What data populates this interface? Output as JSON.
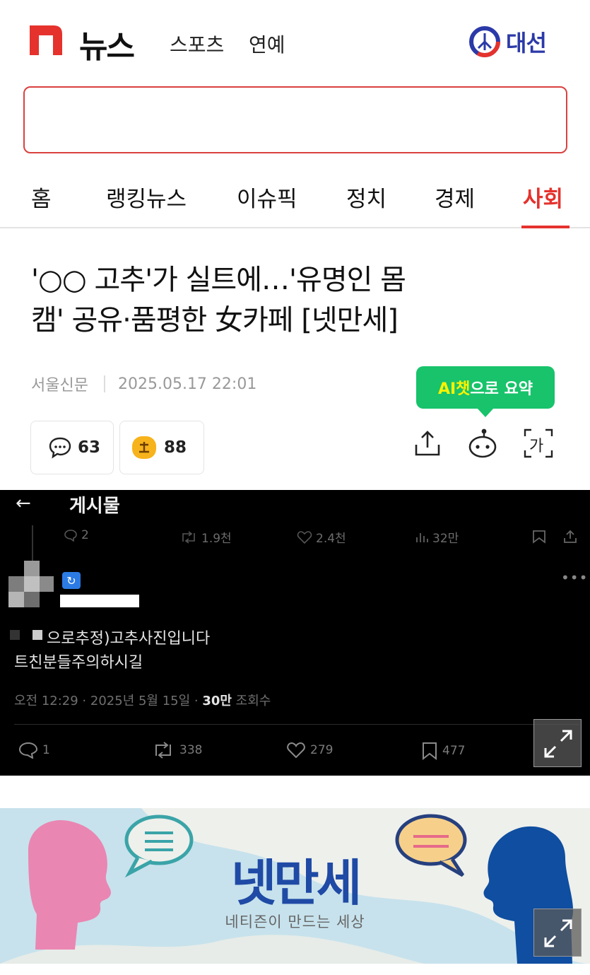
{
  "header": {
    "logo_text": "뉴스",
    "links": [
      "스포츠",
      "연예"
    ],
    "election_label": "대선"
  },
  "tabs": [
    "홈",
    "랭킹뉴스",
    "이슈픽",
    "정치",
    "경제",
    "사회"
  ],
  "active_tab": "사회",
  "article": {
    "title_line1": "'○○ 고추'가 실트에…'유명인 몸",
    "title_line2": "캠' 공유·품평한 女카페 [넷만세]",
    "source": "서울신문",
    "datetime": "2025.05.17 22:01",
    "ai_summary_prefix": "AI챗",
    "ai_summary_suffix": "으로 요약",
    "comment_count": "63",
    "reaction_count": "88",
    "font_icon_label": "가"
  },
  "embedded_post": {
    "back_arrow": "←",
    "title": "게시물",
    "stats": {
      "replies": "2",
      "retweets": "1.9천",
      "likes": "2.4천",
      "views": "32만"
    },
    "verified_badge": "↻",
    "text_line1": "으로추정)고추사진입니다",
    "text_line2": "트친분들주의하시길",
    "timestamp": "오전 12:29 · 2025년 5월 15일 · ",
    "views_bold": "30만",
    "views_label": " 조회수",
    "actions": {
      "replies": "1",
      "retweets": "338",
      "likes": "279",
      "bookmarks": "477"
    },
    "more": "•••"
  },
  "banner": {
    "title": "넷만세",
    "subtitle": "네티즌이 만드는 세상"
  },
  "colors": {
    "brand_red": "#e5322d",
    "election_blue": "#2b3aa8",
    "ai_green": "#18c36b",
    "banner_bg": "#c7e2ec",
    "banner_title": "#1f4aa5"
  }
}
